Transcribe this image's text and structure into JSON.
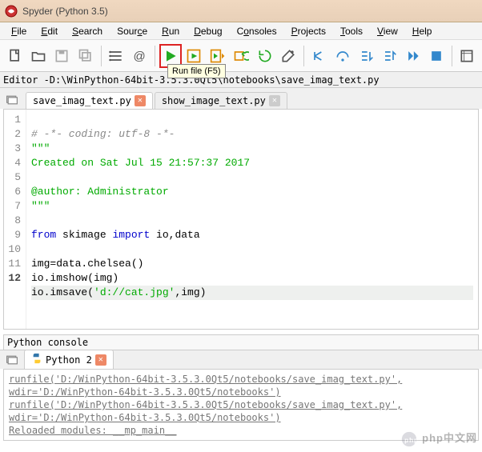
{
  "window": {
    "title": "Spyder (Python 3.5)"
  },
  "menu": {
    "file": "File",
    "edit": "Edit",
    "search": "Search",
    "source": "Source",
    "run": "Run",
    "debug": "Debug",
    "consoles": "Consoles",
    "projects": "Projects",
    "tools": "Tools",
    "view": "View",
    "help": "Help"
  },
  "tooltip": {
    "run": "Run file (F5)"
  },
  "pathbar": {
    "label": "Editor - ",
    "path": "D:\\WinPython-64bit-3.5.3.0Qt5\\notebooks\\save_imag_text.py"
  },
  "editor_tabs": {
    "active": "save_imag_text.py",
    "inactive": "show_image_text.py"
  },
  "code": {
    "l1": "# -*- coding: utf-8 -*-",
    "l2": "\"\"\"",
    "l3": "Created on Sat Jul 15 21:57:37 2017",
    "l5a": "@author:",
    "l5b": " Administrator",
    "l6": "\"\"\"",
    "l8a": "from",
    "l8b": " skimage ",
    "l8c": "import",
    "l8d": " io,data",
    "l10": "img=data.chelsea()",
    "l11": "io.imshow(img)",
    "l12a": "io.imsave(",
    "l12b": "'d://cat.jpg'",
    "l12c": ",img)"
  },
  "line_numbers": [
    "1",
    "2",
    "3",
    "4",
    "5",
    "6",
    "7",
    "8",
    "9",
    "10",
    "11",
    "12"
  ],
  "console": {
    "label": "Python console",
    "tab": "Python 2",
    "l1": "runfile('D:/WinPython-64bit-3.5.3.0Qt5/notebooks/save_imag_text.py', wdir='D:/WinPython-64bit-3.5.3.0Qt5/notebooks')",
    "l2": "runfile('D:/WinPython-64bit-3.5.3.0Qt5/notebooks/save_imag_text.py', wdir='D:/WinPython-64bit-3.5.3.0Qt5/notebooks')",
    "l3": "Reloaded modules: __mp_main__"
  },
  "watermark": "php中文网"
}
